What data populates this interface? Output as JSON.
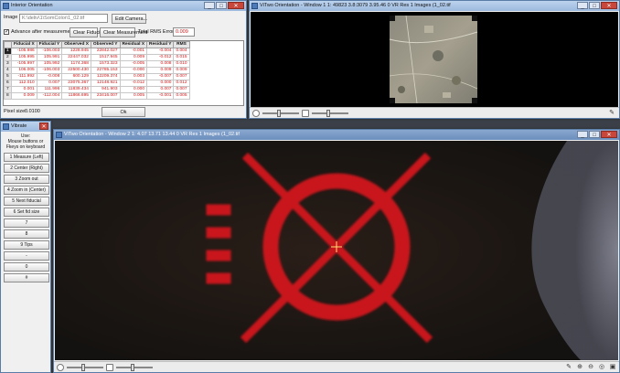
{
  "interior": {
    "title": "Interior Orientation",
    "image_label": "Image",
    "image_path": "K:\\deliv\\1\\SomColor\\1_02.tif",
    "edit_camera": "Edit Camera...",
    "advance_label": "Advance after measurement",
    "clear_fiducial": "Clear Fiducial",
    "clear_measurement": "Clear Measurement",
    "total_rms_label": "Total RMS Error",
    "total_rms_value": "0.009",
    "columns": [
      "Fiducial X",
      "Fiducial Y",
      "Observed X",
      "Observed Y",
      "Residual X",
      "Residual Y",
      "RMS"
    ],
    "rows": [
      {
        "id": "1",
        "cells": [
          "-105.986",
          "-106.003",
          "1228.945",
          "22842.027",
          "-0.001",
          "-0.004",
          "0.004"
        ]
      },
      {
        "id": "2",
        "cells": [
          "105.995",
          "105.991",
          "22447.032",
          "1517.945",
          "0.009",
          "-0.012",
          "0.015"
        ]
      },
      {
        "id": "3",
        "cells": [
          "-105.997",
          "105.992",
          "1174.368",
          "1573.323",
          "-0.005",
          "0.008",
          "0.010"
        ]
      },
      {
        "id": "4",
        "cells": [
          "106.005",
          "-106.003",
          "22500.430",
          "22785.153",
          "-0.000",
          "0.009",
          "0.009"
        ]
      },
      {
        "id": "5",
        "cells": [
          "-111.992",
          "-0.008",
          "600.129",
          "12209.374",
          "0.003",
          "-0.007",
          "0.007"
        ]
      },
      {
        "id": "6",
        "cells": [
          "112.010",
          "0.007",
          "23075.367",
          "12148.921",
          "-0.012",
          "0.000",
          "0.012"
        ]
      },
      {
        "id": "7",
        "cells": [
          "0.001",
          "111.996",
          "11839.434",
          "941.903",
          "0.000",
          "0.007",
          "0.007"
        ]
      },
      {
        "id": "8",
        "cells": [
          "0.009",
          "-112.004",
          "11866.695",
          "23416.007",
          "0.005",
          "-0.001",
          "0.005"
        ]
      }
    ],
    "pixel_size_label": "Pixel size:",
    "pixel_size_value": "0.0100",
    "ok": "Ok"
  },
  "viewer1": {
    "title": "ViTwo Orientation - Window 1   1: 49823   3.8:3079   3.95.46   0 VR Res   1 Images (1_02.tif"
  },
  "viewer2": {
    "title": "ViTwo Orientation - Window 2   1: 4.07   13.71   13.44   0 VR Res   1 Images (1_02.tif"
  },
  "vibrate": {
    "title": "Vibrate",
    "instructions": [
      "Use:",
      "Mouse buttons or",
      "Fkeys on keyboard"
    ],
    "buttons": [
      "1 Measure (Left)",
      "2 Center  (Right)",
      "3 Zoom out",
      "4 Zoom in (Center)",
      "5 Next fiducial",
      "6 Set fid size",
      "7",
      "8",
      "9 Tips",
      "-",
      "0",
      "#"
    ]
  },
  "colors": {
    "fiducial_red": "#c8141a",
    "cursor": "#ffe070"
  },
  "icons": [
    "contrast-icon",
    "reset-icon",
    "pan-icon",
    "zoom-in-icon",
    "zoom-out-icon",
    "fit-icon",
    "settings-icon"
  ]
}
